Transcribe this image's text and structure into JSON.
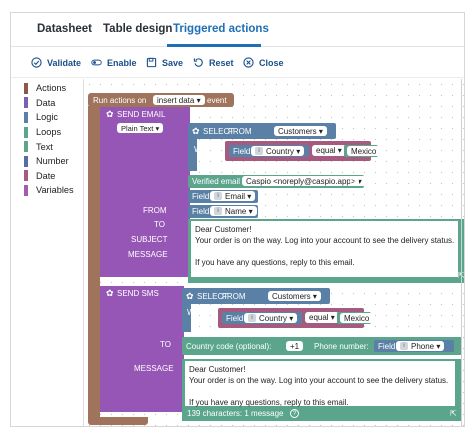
{
  "tabs": [
    {
      "label": "Datasheet"
    },
    {
      "label": "Table design"
    },
    {
      "label": "Triggered actions"
    }
  ],
  "toolbar": {
    "validate": "Validate",
    "enable": "Enable",
    "save": "Save",
    "reset": "Reset",
    "close": "Close"
  },
  "categories": [
    {
      "label": "Actions",
      "color": "#8a5a44"
    },
    {
      "label": "Data",
      "color": "#7b5fb0"
    },
    {
      "label": "Logic",
      "color": "#5b80a5"
    },
    {
      "label": "Loops",
      "color": "#5ba58c"
    },
    {
      "label": "Text",
      "color": "#5ba58c"
    },
    {
      "label": "Number",
      "color": "#5b6aa5"
    },
    {
      "label": "Date",
      "color": "#a55b80"
    },
    {
      "label": "Variables",
      "color": "#a55bb0"
    }
  ],
  "colors": {
    "action": "#a0745c",
    "email": "#9556b5",
    "select": "#5b80a5",
    "where": "#a55b80",
    "field": "#5ba58c",
    "text": "#5ba58c"
  },
  "event": {
    "prefix": "Run actions on",
    "value": "insert data",
    "suffix": "event"
  },
  "send_email": {
    "title": "SEND EMAIL",
    "format": "Plain Text",
    "select": "SELECT",
    "from": "FROM",
    "table": "Customers",
    "where": "WHERE",
    "field": "Field",
    "field_name": "Country",
    "op": "equal",
    "value": "Mexico",
    "labels": {
      "from": "FROM",
      "to": "TO",
      "subject": "SUBJECT",
      "message": "MESSAGE"
    },
    "from_kw": "Verified email",
    "from_value": "Caspio <noreply@caspio.app>",
    "to_field": "Email",
    "subject_field": "Name",
    "message": "Dear Customer!\nYour order is on the way. Log into your account to see the delivery status.\n\nIf you have any questions, reply to this email."
  },
  "send_sms": {
    "title": "SEND SMS",
    "select": "SELECT",
    "from": "FROM",
    "table": "Customers",
    "where": "WHERE",
    "field": "Field",
    "field_name": "Country",
    "op": "equal",
    "value": "Mexico",
    "labels": {
      "to": "TO",
      "message": "MESSAGE"
    },
    "country_label": "Country code (optional):",
    "country_value": "+1",
    "phone_label": "Phone number:",
    "phone_field": "Phone",
    "message": "Dear Customer!\nYour order is on the way. Log into your account to see the delivery status.\n\nIf you have any questions, reply to this email.",
    "counter": "139 characters: 1 message"
  }
}
